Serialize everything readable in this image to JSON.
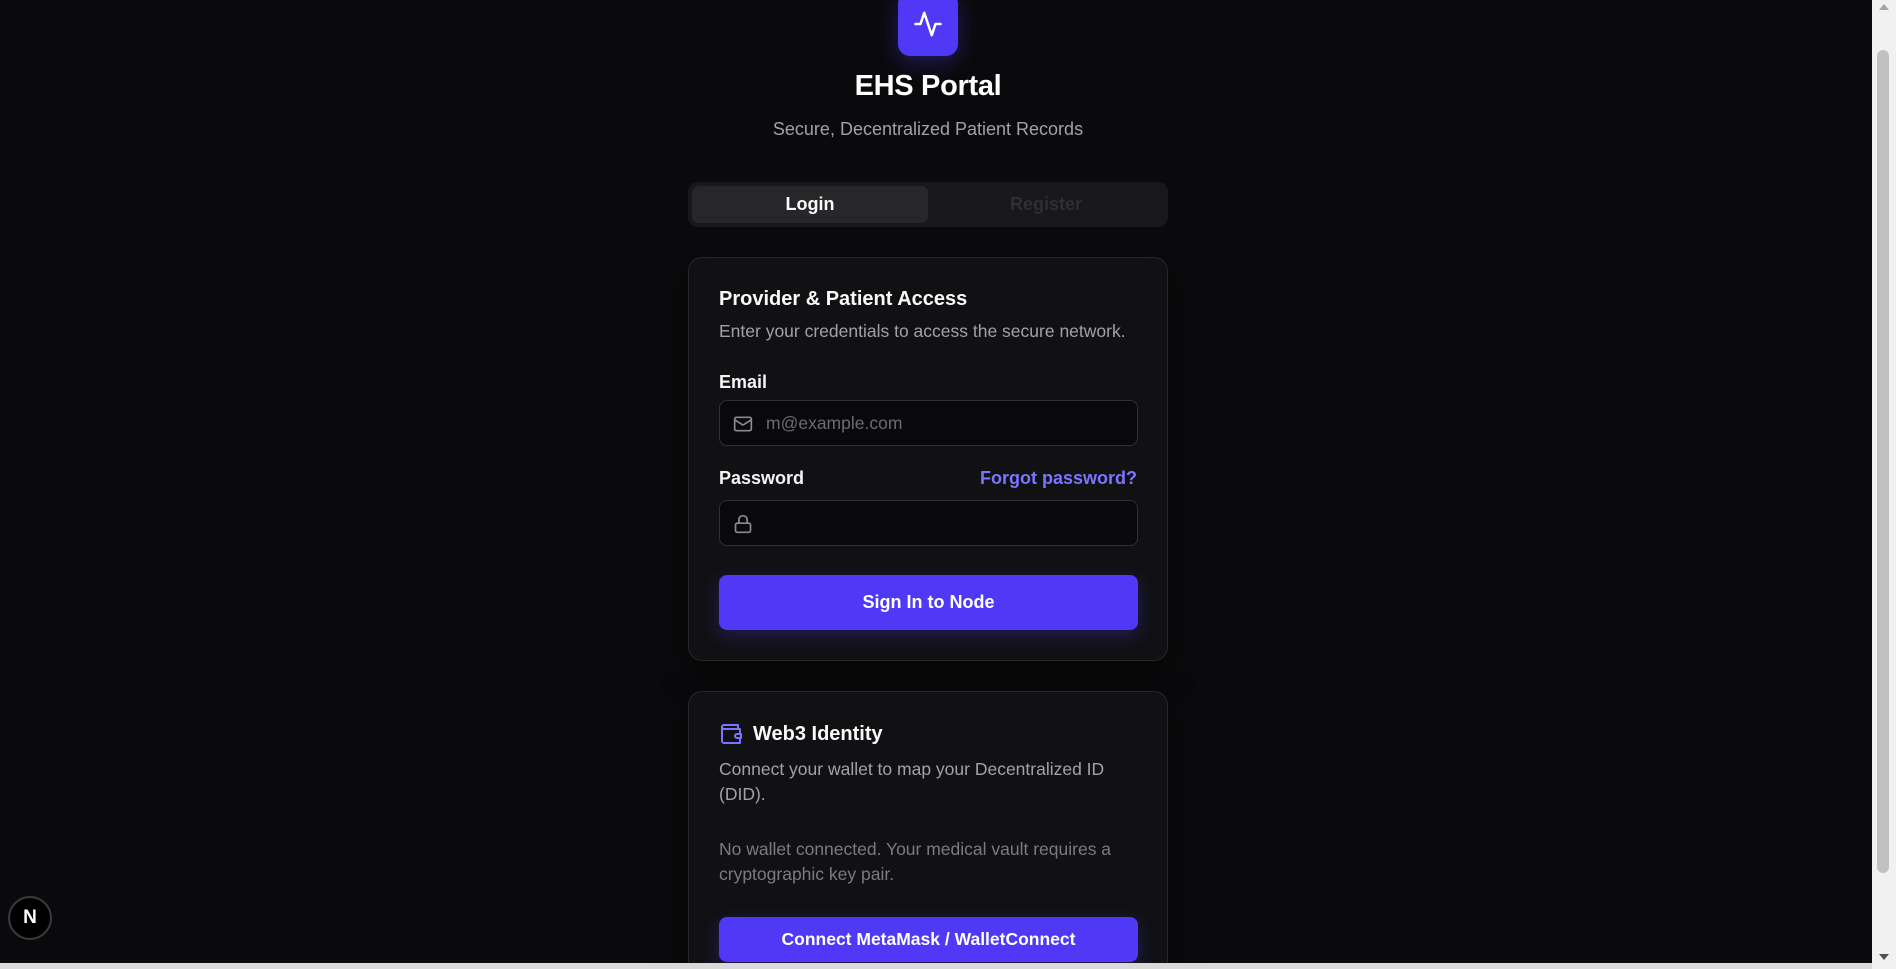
{
  "brand": {
    "logo_icon": "activity-pulse-icon",
    "accent_color": "#4f39f6",
    "title": "EHS Portal",
    "subtitle": "Secure, Decentralized Patient Records"
  },
  "tabs": [
    {
      "label": "Login",
      "active": true
    },
    {
      "label": "Register",
      "active": false
    }
  ],
  "login_card": {
    "title": "Provider & Patient Access",
    "description": "Enter your credentials to access the secure network.",
    "email": {
      "label": "Email",
      "placeholder": "m@example.com",
      "value": "",
      "icon": "mail-icon"
    },
    "password": {
      "label": "Password",
      "forgot_label": "Forgot password?",
      "value": "",
      "icon": "lock-icon"
    },
    "submit_label": "Sign In to Node"
  },
  "web3_card": {
    "icon": "wallet-icon",
    "title": "Web3 Identity",
    "description": "Connect your wallet to map your Decentralized ID (DID).",
    "status": "No wallet connected. Your medical vault requires a cryptographic key pair.",
    "connect_label": "Connect MetaMask / WalletConnect"
  },
  "dev_badge": {
    "label": "N",
    "icon": "nextjs-icon"
  }
}
